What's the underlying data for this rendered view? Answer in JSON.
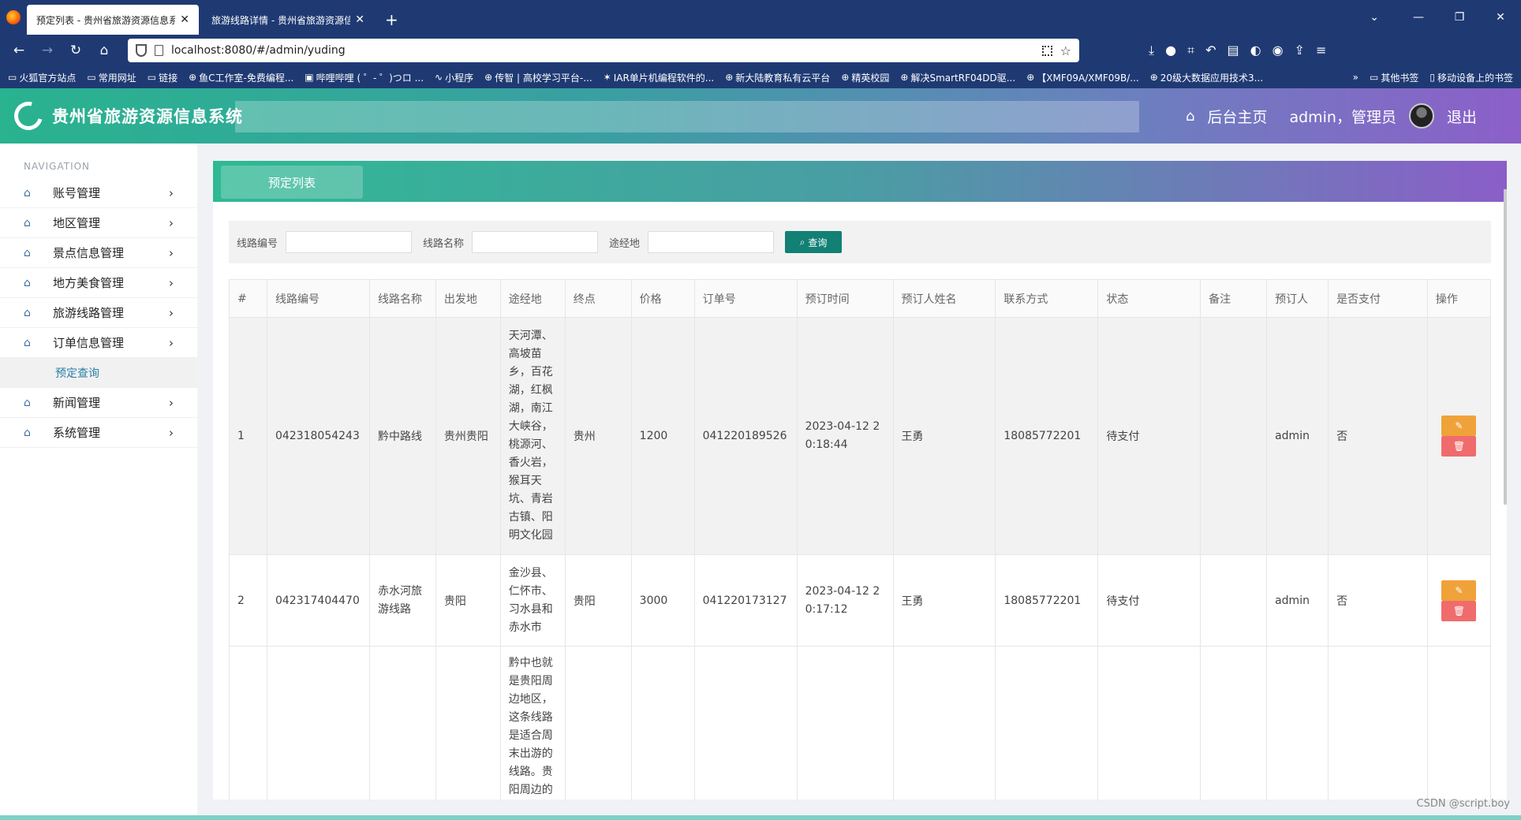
{
  "browser": {
    "tabs": [
      {
        "title": "预定列表 - 贵州省旅游资源信息系统",
        "active": true
      },
      {
        "title": "旅游线路详情 - 贵州省旅游资源信息系统",
        "active": false
      }
    ],
    "url": "localhost:8080/#/admin/yuding",
    "bookmarks": [
      "火狐官方站点",
      "常用网址",
      "链接",
      "鱼C工作室-免费编程...",
      "哔哩哔哩 ( ゜- ゜)つロ ...",
      "小程序",
      "传智 | 高校学习平台-...",
      "IAR单片机编程软件的...",
      "新大陆教育私有云平台",
      "精英校园",
      "解决SmartRF04DD驱...",
      "【XMF09A/XMF09B/...",
      "20级大数据应用技术3..."
    ],
    "bookmarks_right": [
      "其他书签",
      "移动设备上的书签"
    ]
  },
  "header": {
    "title": "贵州省旅游资源信息系统",
    "home_link": "后台主页",
    "user": "admin，管理员",
    "logout": "退出"
  },
  "sidebar": {
    "heading": "NAVIGATION",
    "items": [
      {
        "label": "账号管理"
      },
      {
        "label": "地区管理"
      },
      {
        "label": "景点信息管理"
      },
      {
        "label": "地方美食管理"
      },
      {
        "label": "旅游线路管理"
      },
      {
        "label": "订单信息管理"
      }
    ],
    "sub_item": "预定查询",
    "items_after": [
      {
        "label": "新闻管理"
      },
      {
        "label": "系统管理"
      }
    ]
  },
  "panel": {
    "tab": "预定列表"
  },
  "search": {
    "route_no_label": "线路编号",
    "route_name_label": "线路名称",
    "via_label": "途经地",
    "button": "查询"
  },
  "table": {
    "headers": [
      "#",
      "线路编号",
      "线路名称",
      "出发地",
      "途经地",
      "终点",
      "价格",
      "订单号",
      "预订时间",
      "预订人姓名",
      "联系方式",
      "状态",
      "备注",
      "预订人",
      "是否支付",
      "操作"
    ],
    "rows": [
      {
        "idx": "1",
        "route_no": "042318054243",
        "route_name": "黔中路线",
        "start": "贵州贵阳",
        "via": [
          "天河潭、",
          "高坡苗",
          "乡，百花",
          "湖，红枫",
          "湖，南江",
          "大峡谷，",
          "桃源河、",
          "香火岩，",
          "猴耳天",
          "坑、青岩",
          "古镇、阳",
          "明文化园"
        ],
        "end": "贵州",
        "price": "1200",
        "order_no": "041220189526",
        "time": [
          "2023-04-12 2",
          "0:18:44"
        ],
        "name": "王勇",
        "phone": "18085772201",
        "status": "待支付",
        "note": "",
        "user": "admin",
        "paid": "否"
      },
      {
        "idx": "2",
        "route_no": "042317404470",
        "route_name": [
          "赤水河旅",
          "游线路"
        ],
        "start": "贵阳",
        "via": [
          "金沙县、",
          "仁怀市、",
          "习水县和",
          "赤水市"
        ],
        "end": "贵阳",
        "price": "3000",
        "order_no": "041220173127",
        "time": [
          "2023-04-12 2",
          "0:17:12"
        ],
        "name": "王勇",
        "phone": "18085772201",
        "status": "待支付",
        "note": "",
        "user": "admin",
        "paid": "否"
      },
      {
        "via": [
          "黔中也就",
          "是贵阳周",
          "边地区，",
          "这条线路",
          "是适合周",
          "末出游的",
          "线路。贵",
          "阳周边的"
        ]
      }
    ]
  },
  "watermark": "CSDN @script.boy"
}
